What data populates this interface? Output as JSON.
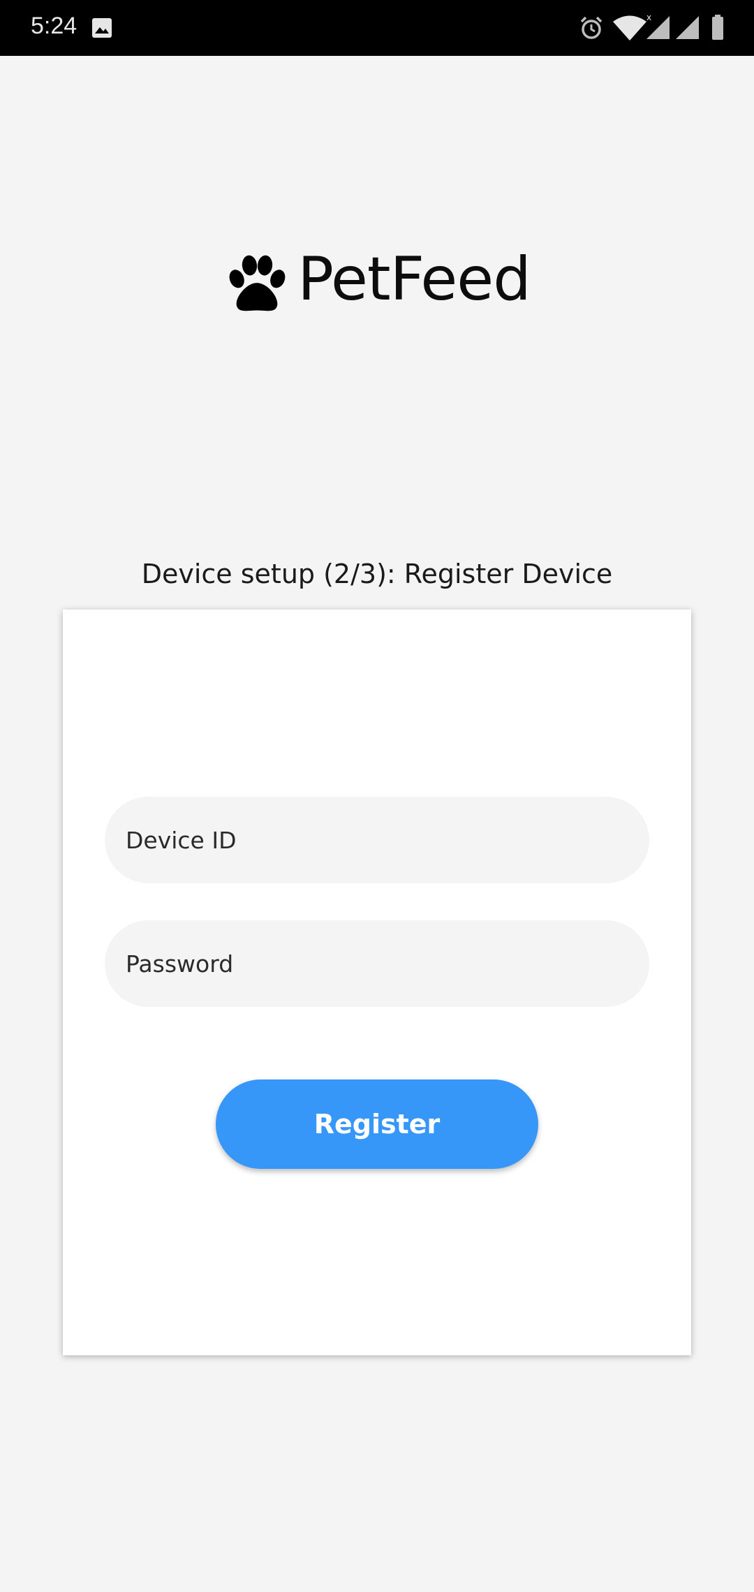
{
  "status_bar": {
    "time": "5:24",
    "icons": [
      "image-icon",
      "alarm-icon",
      "wifi-icon",
      "signal-icon",
      "signal-icon",
      "battery-icon"
    ]
  },
  "app": {
    "name": "PetFeed",
    "logo_icon": "paw-icon"
  },
  "setup": {
    "title": "Device setup (2/3): Register Device"
  },
  "form": {
    "device_id_placeholder": "Device ID",
    "password_placeholder": "Password",
    "register_label": "Register"
  },
  "colors": {
    "background": "#f4f4f4",
    "card": "#ffffff",
    "accent": "#3797f8",
    "field": "#f4f4f4"
  }
}
